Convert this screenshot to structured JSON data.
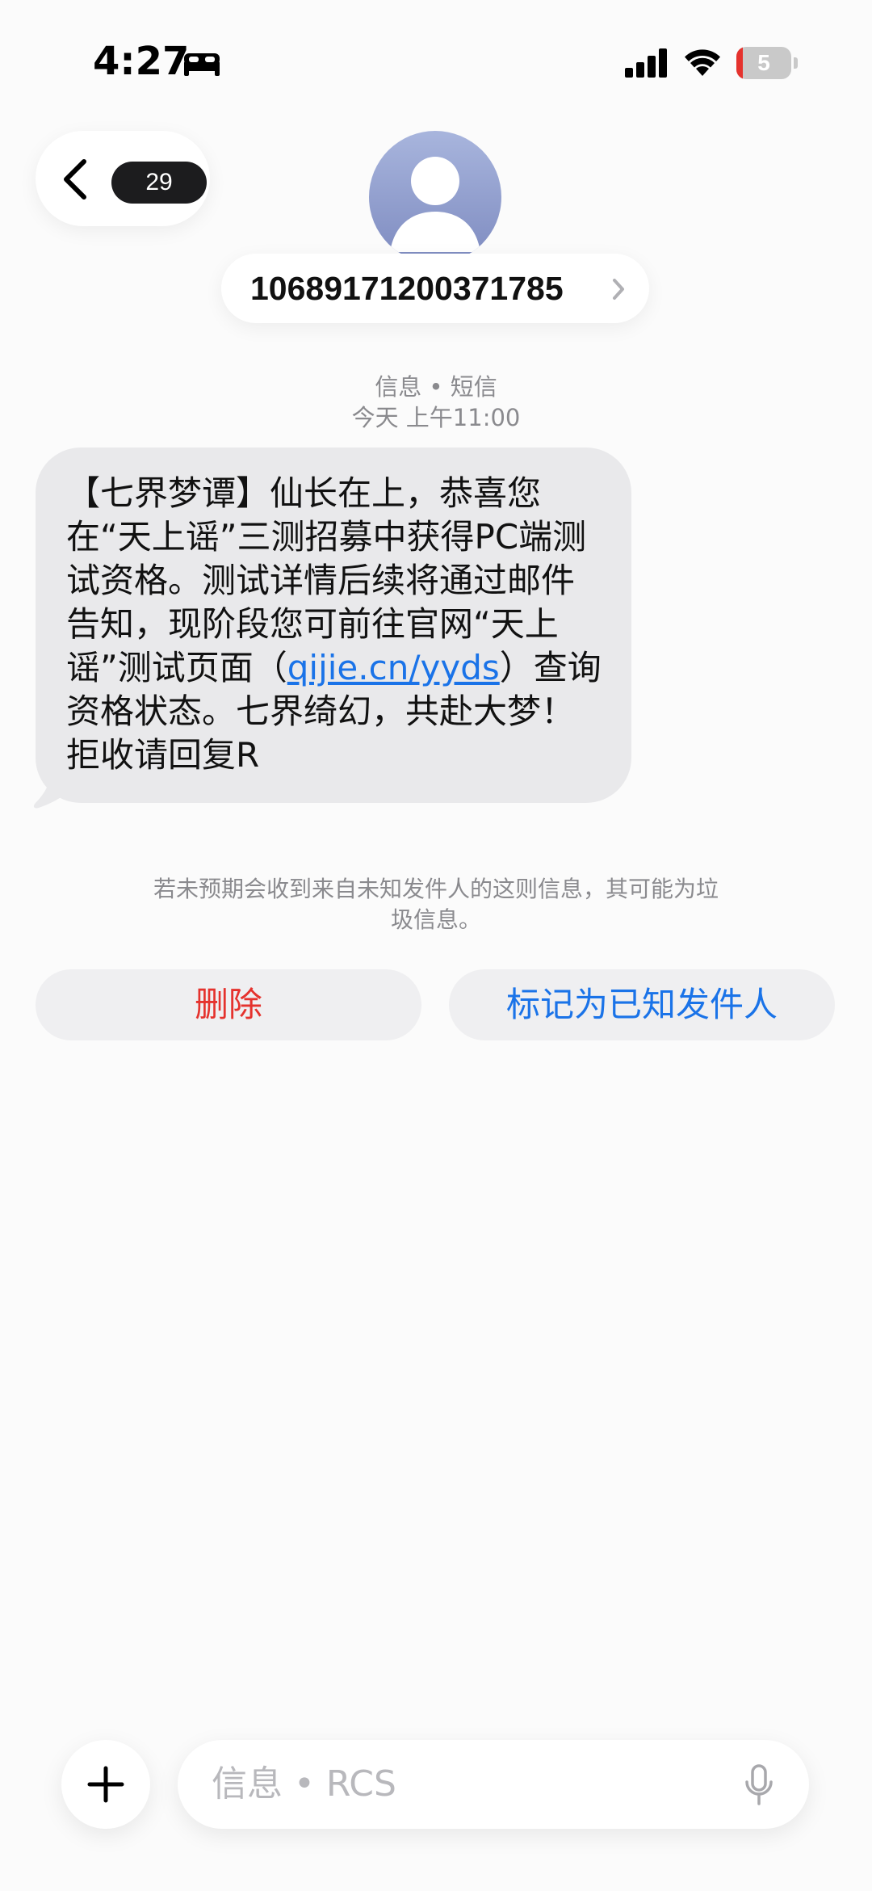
{
  "status_bar": {
    "time": "4:27",
    "battery_level": "5",
    "icons": [
      "sleep-focus-icon",
      "cellular-signal-icon",
      "wifi-icon",
      "battery-icon"
    ]
  },
  "header": {
    "unread_count": "29",
    "sender_number": "10689171200371785",
    "avatar_icon": "person-silhouette-icon"
  },
  "conversation": {
    "channel_label": "信息 • 短信",
    "timestamp": "今天 上午11:00",
    "message": {
      "text_before_link": "【七界梦谭】仙长在上，恭喜您在“天上谣”三测招募中获得PC端测试资格。测试详情后续将通过邮件告知，现阶段您可前往官网“天上谣”测试页面（",
      "link_text": "qijie.cn/yyds",
      "text_after_link": "）查询资格状态。七界绮幻，共赴大梦！拒收请回复R"
    },
    "spam_notice": "若未预期会收到来自未知发件人的这则信息，其可能为垃圾信息。"
  },
  "actions": {
    "delete_label": "删除",
    "mark_known_label": "标记为已知发件人"
  },
  "composer": {
    "placeholder": "信息 • RCS"
  },
  "colors": {
    "accent_blue": "#1a73e8",
    "destructive_red": "#e5322d",
    "bubble_gray": "#e9e9eb",
    "badge_dark": "#1c1c1e"
  }
}
